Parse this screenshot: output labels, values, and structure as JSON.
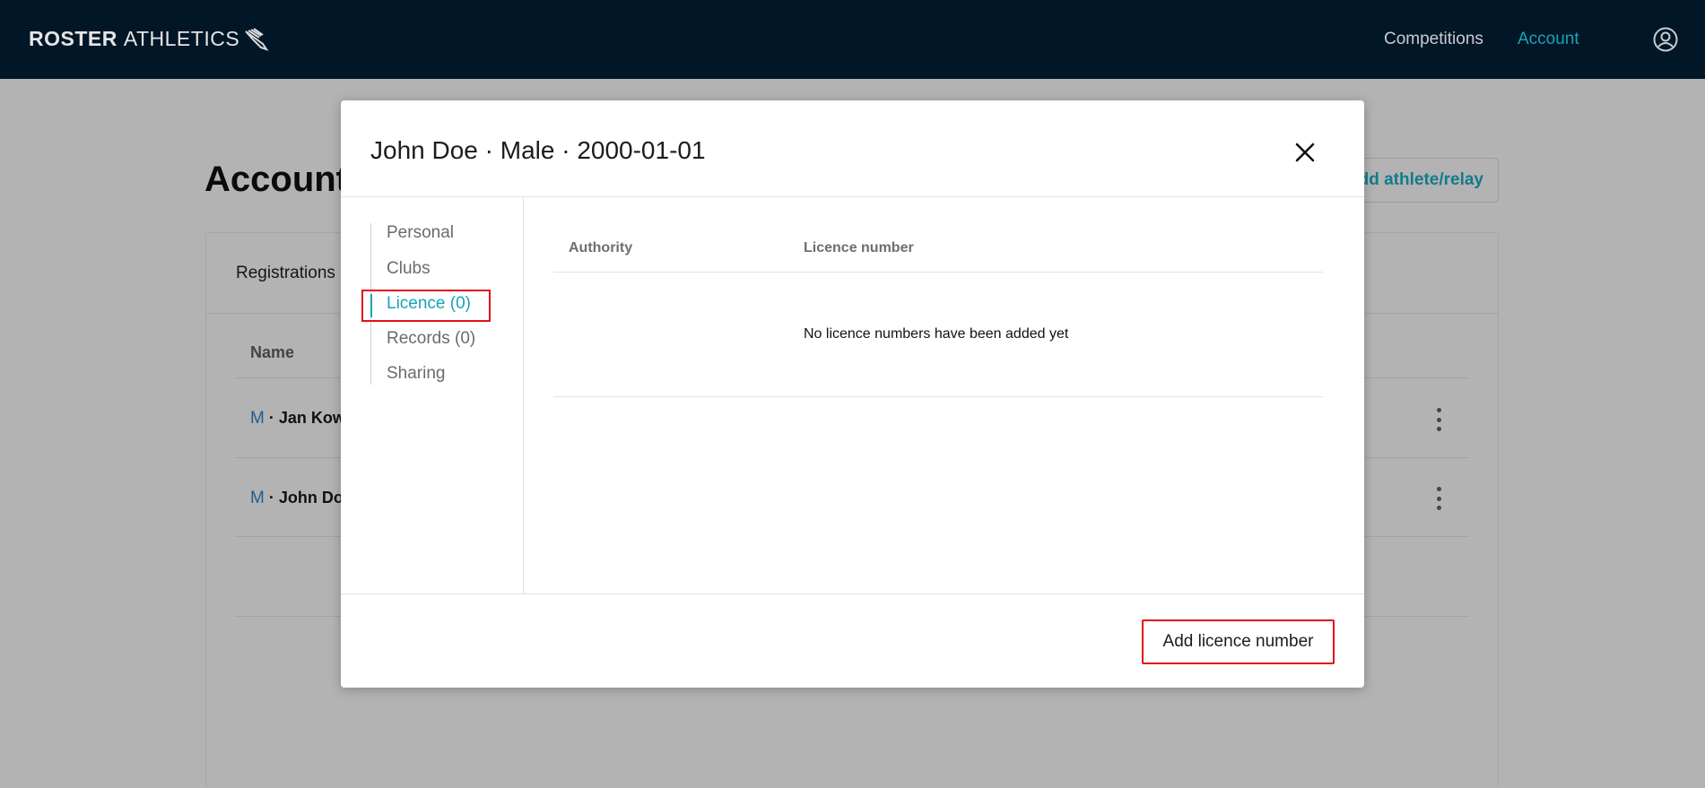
{
  "app": {
    "logo_bold": "ROSTER",
    "logo_thin": "ATHLETICS"
  },
  "nav": {
    "competitions": "Competitions",
    "account": "Account"
  },
  "background": {
    "page_title": "Account",
    "add_button": "Add athlete/relay",
    "tab": "Registrations",
    "column_name": "Name",
    "rows": [
      {
        "gender": "M",
        "name": " · Jan Kow"
      },
      {
        "gender": "M",
        "name": " · John Do"
      }
    ]
  },
  "modal": {
    "title": "John Doe · Male · 2000-01-01",
    "side_nav": [
      "Personal",
      "Clubs",
      "Licence (0)",
      "Records (0)",
      "Sharing"
    ],
    "active_tab": "Licence (0)",
    "table": {
      "col_authority": "Authority",
      "col_licence": "Licence number",
      "empty": "No licence numbers have been added yet"
    },
    "add_button": "Add licence number"
  },
  "colors": {
    "topbar": "#011627",
    "accent": "#1aa3b8",
    "highlight": "#e0101a"
  },
  "icons": {
    "close": "close-icon",
    "user": "user-circle-icon",
    "logo": "winged-foot-icon",
    "row_menu": "kebab-menu-icon"
  }
}
